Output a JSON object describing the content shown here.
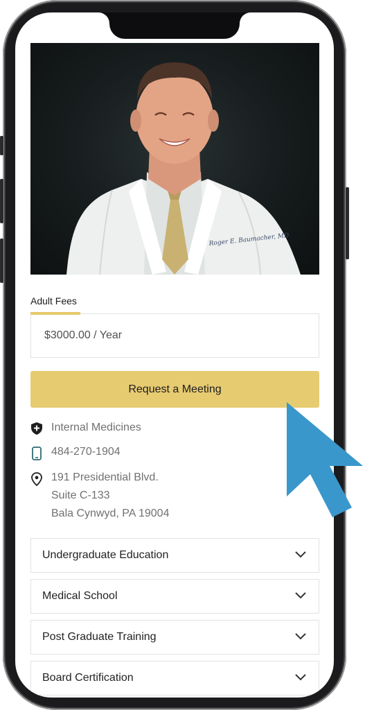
{
  "fees": {
    "tab_label": "Adult Fees",
    "price": "$3000.00 / Year"
  },
  "cta": {
    "label": "Request a Meeting"
  },
  "info": {
    "specialty": "Internal Medicines",
    "phone": "484-270-1904",
    "address": [
      "191 Presidential Blvd.",
      "Suite C-133",
      "Bala Cynwyd, PA 19004"
    ]
  },
  "accordion": [
    {
      "label": "Undergraduate Education"
    },
    {
      "label": "Medical School"
    },
    {
      "label": "Post Graduate Training"
    },
    {
      "label": "Board Certification"
    }
  ],
  "photo": {
    "coat_embroidery": "Roger E. Baumacher, MD"
  },
  "colors": {
    "accent": "#e7cb71",
    "cursor": "#3a97cc",
    "icon_phone": "#2d6b72"
  }
}
